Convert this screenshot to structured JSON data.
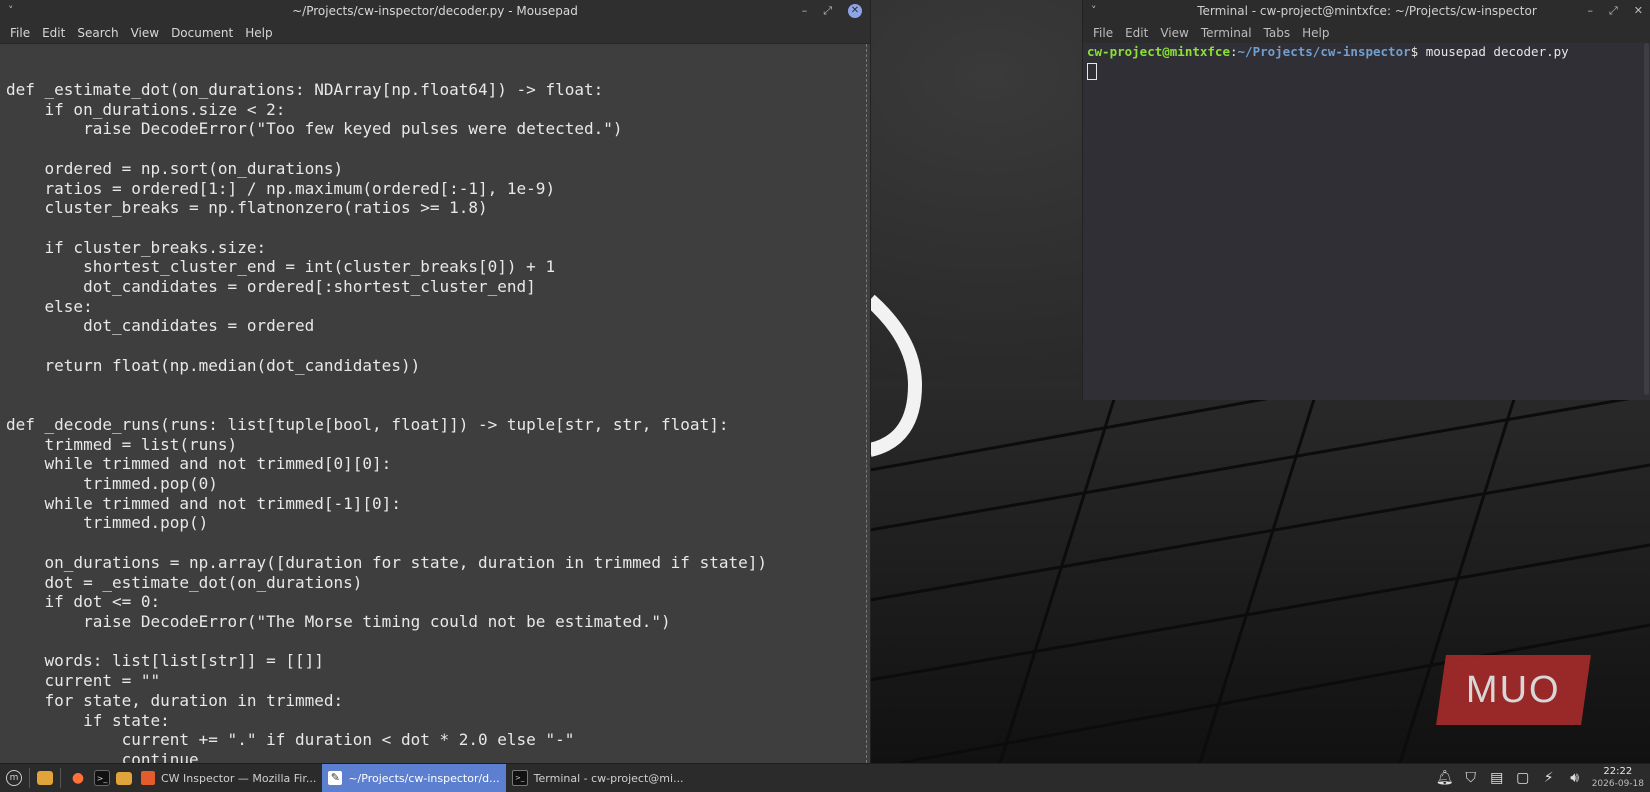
{
  "mousepad": {
    "title": "~/Projects/cw-inspector/decoder.py - Mousepad",
    "menu": [
      "File",
      "Edit",
      "Search",
      "View",
      "Document",
      "Help"
    ],
    "code": "def _estimate_dot(on_durations: NDArray[np.float64]) -> float:\n    if on_durations.size < 2:\n        raise DecodeError(\"Too few keyed pulses were detected.\")\n\n    ordered = np.sort(on_durations)\n    ratios = ordered[1:] / np.maximum(ordered[:-1], 1e-9)\n    cluster_breaks = np.flatnonzero(ratios >= 1.8)\n\n    if cluster_breaks.size:\n        shortest_cluster_end = int(cluster_breaks[0]) + 1\n        dot_candidates = ordered[:shortest_cluster_end]\n    else:\n        dot_candidates = ordered\n\n    return float(np.median(dot_candidates))\n\n\ndef _decode_runs(runs: list[tuple[bool, float]]) -> tuple[str, str, float]:\n    trimmed = list(runs)\n    while trimmed and not trimmed[0][0]:\n        trimmed.pop(0)\n    while trimmed and not trimmed[-1][0]:\n        trimmed.pop()\n\n    on_durations = np.array([duration for state, duration in trimmed if state])\n    dot = _estimate_dot(on_durations)\n    if dot <= 0:\n        raise DecodeError(\"The Morse timing could not be estimated.\")\n\n    words: list[list[str]] = [[]]\n    current = \"\"\n    for state, duration in trimmed:\n        if state:\n            current += \".\" if duration < dot * 2.0 else \"-\"\n            continue"
  },
  "terminal": {
    "title": "Terminal - cw-project@mintxfce: ~/Projects/cw-inspector",
    "menu": [
      "File",
      "Edit",
      "View",
      "Terminal",
      "Tabs",
      "Help"
    ],
    "prompt_user": "cw-project@mintxfce",
    "prompt_path": "~/Projects/cw-inspector",
    "prompt_symbol": "$",
    "command": "mousepad decoder.py"
  },
  "watermark": "MUO",
  "taskbar": {
    "tasks": [
      {
        "label": "CW Inspector — Mozilla Fir...",
        "icon": "firefox-icon",
        "active": false
      },
      {
        "label": "~/Projects/cw-inspector/d...",
        "icon": "mousepad-icon",
        "active": true
      },
      {
        "label": "Terminal - cw-project@mi...",
        "icon": "terminal-icon",
        "active": false
      }
    ],
    "clock_time": "22:22",
    "clock_date": "2026-09-18"
  },
  "colors": {
    "accent": "#5c7fcf",
    "prompt_user": "#8ae234",
    "prompt_path": "#729fcf",
    "watermark_bg": "#a52a2a"
  }
}
